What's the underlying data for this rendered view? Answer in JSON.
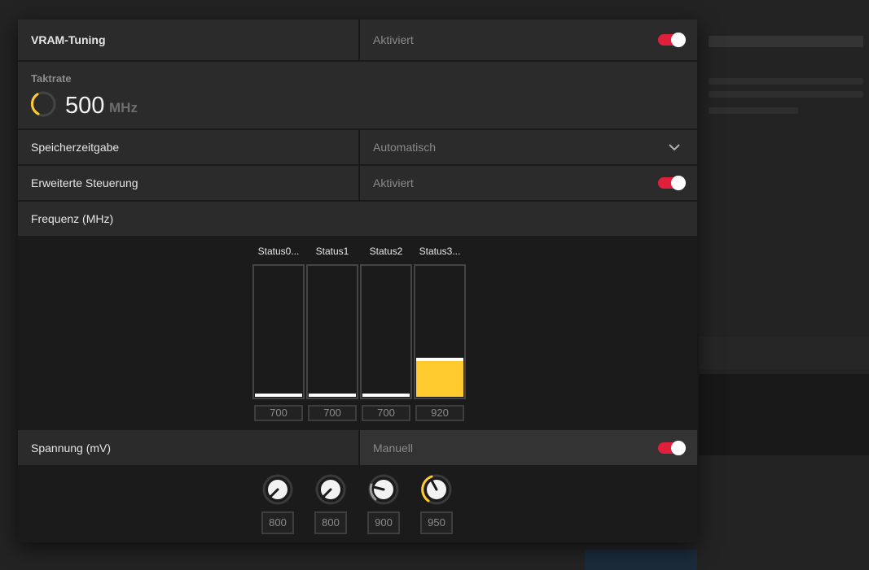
{
  "vram_tuning": {
    "label": "VRAM-Tuning",
    "value": "Aktiviert",
    "enabled": true
  },
  "clock": {
    "title": "Taktrate",
    "value": "500",
    "unit": "MHz"
  },
  "memory_timing": {
    "label": "Speicherzeitgabe",
    "value": "Automatisch"
  },
  "advanced_control": {
    "label": "Erweiterte Steuerung",
    "value": "Aktiviert",
    "enabled": true
  },
  "frequency": {
    "label": "Frequenz (MHz)",
    "states": [
      {
        "name": "Status0...",
        "value": "700"
      },
      {
        "name": "Status1",
        "value": "700"
      },
      {
        "name": "Status2",
        "value": "700"
      },
      {
        "name": "Status3...",
        "value": "920"
      }
    ]
  },
  "voltage": {
    "label": "Spannung (mV)",
    "value": "Manuell",
    "enabled": true,
    "states": [
      {
        "value": "800"
      },
      {
        "value": "800"
      },
      {
        "value": "900"
      },
      {
        "value": "950"
      }
    ]
  },
  "colors": {
    "accent_red": "#e0203a",
    "accent_yellow": "#ffcb2f",
    "panel_row": "#2b2b2b",
    "panel_bg": "#1a1a1a"
  },
  "icons": {
    "toggle": "toggle-switch",
    "dropdown": "chevron-down-icon",
    "gauge": "gauge-icon",
    "knob": "dial-knob-icon"
  }
}
